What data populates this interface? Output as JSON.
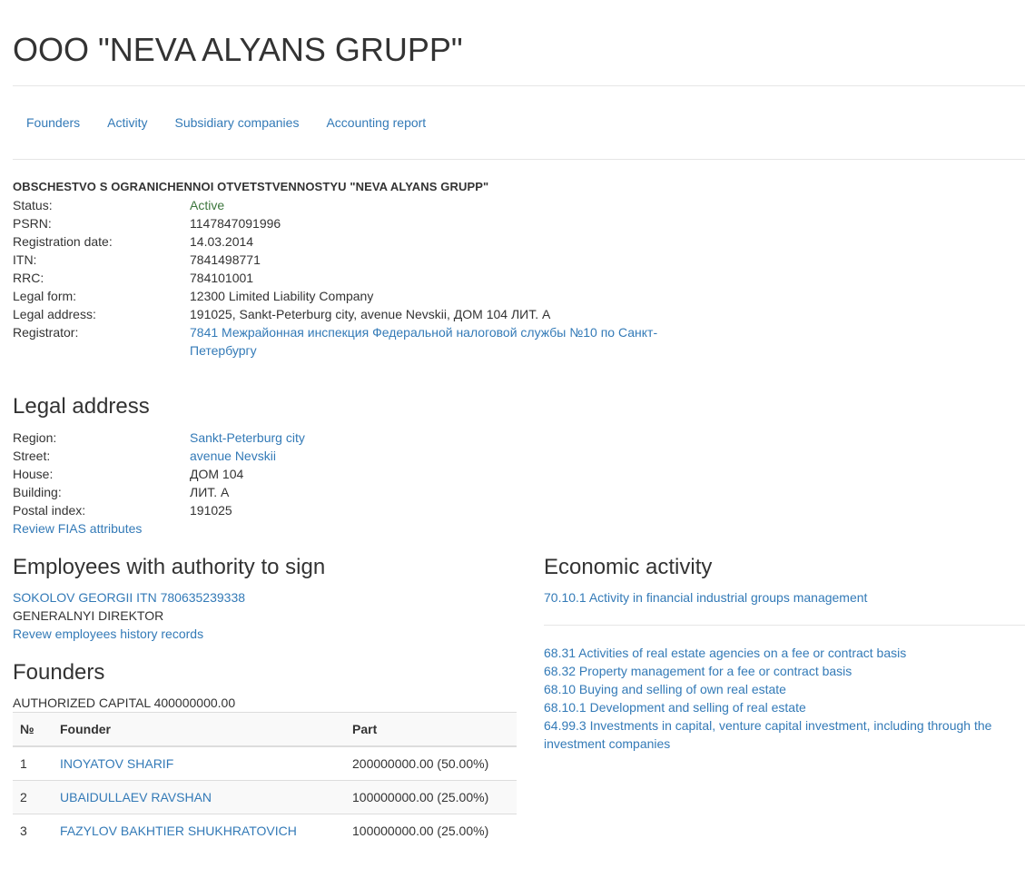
{
  "title": "OOO \"NEVA ALYANS GRUPP\"",
  "nav": [
    "Founders",
    "Activity",
    "Subsidiary companies",
    "Accounting report"
  ],
  "full_name": "OBSCHESTVO S OGRANICHENNOI OTVETSTVENNOSTYU \"NEVA ALYANS GRUPP\"",
  "info": {
    "status": {
      "label": "Status:",
      "value": "Active"
    },
    "psrn": {
      "label": "PSRN:",
      "value": "1147847091996"
    },
    "registration_date": {
      "label": "Registration date:",
      "value": "14.03.2014"
    },
    "itn": {
      "label": "ITN:",
      "value": "7841498771"
    },
    "rrc": {
      "label": "RRC:",
      "value": "784101001"
    },
    "legal_form": {
      "label": "Legal form:",
      "value": "12300 Limited Liability Company"
    },
    "legal_address": {
      "label": "Legal address:",
      "value": "191025, Sankt-Peterburg city, avenue Nevskii, ДОМ 104 ЛИТ. А"
    },
    "registrator": {
      "label": "Registrator:",
      "value": "7841 Межрайонная инспекция Федеральной налоговой службы №10 по Санкт-Петербургу"
    }
  },
  "legal_address_section": {
    "title": "Legal address",
    "region": {
      "label": "Region:",
      "value": "Sankt-Peterburg city"
    },
    "street": {
      "label": "Street:",
      "value": "avenue Nevskii"
    },
    "house": {
      "label": "House:",
      "value": "ДОМ 104"
    },
    "building": {
      "label": "Building:",
      "value": "ЛИТ. А"
    },
    "postal_index": {
      "label": "Postal index:",
      "value": "191025"
    },
    "fias_link": "Review FIAS attributes"
  },
  "employees": {
    "title": "Employees with authority to sign",
    "person": "SOKOLOV GEORGII ITN 780635239338",
    "position": "GENERALNYI DIREKTOR",
    "history_link": "Revew employees history records"
  },
  "founders": {
    "title": "Founders",
    "capital": "AUTHORIZED CAPITAL 400000000.00",
    "headers": [
      "№",
      "Founder",
      "Part"
    ],
    "rows": [
      [
        "1",
        "INOYATOV SHARIF",
        "200000000.00 (50.00%)"
      ],
      [
        "2",
        "UBAIDULLAEV RAVSHAN",
        "100000000.00 (25.00%)"
      ],
      [
        "3",
        "FAZYLOV BAKHTIER SHUKHRATOVICH",
        "100000000.00 (25.00%)"
      ]
    ]
  },
  "economic_activity": {
    "title": "Economic activity",
    "main": "70.10.1 Activity in financial industrial groups management",
    "additional": [
      "68.31 Activities of real estate agencies on a fee or contract basis",
      "68.32 Property management for a fee or contract basis",
      "68.10 Buying and selling of own real estate",
      "68.10.1 Development and selling of real estate",
      "64.99.3 Investments in capital, venture capital investment, including through the investment companies"
    ]
  }
}
